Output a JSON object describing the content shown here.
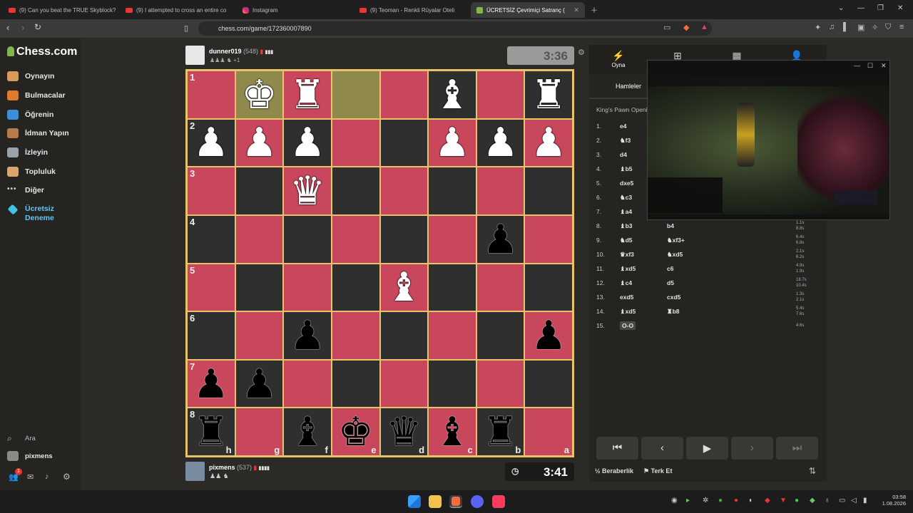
{
  "browser": {
    "tabs": [
      {
        "label": "(9) Can you beat the TRUE Skyblock?",
        "icon": "youtube-icon"
      },
      {
        "label": "(9) I attempted to cross an entire co",
        "icon": "youtube-icon"
      },
      {
        "label": "Instagram",
        "icon": "instagram-icon"
      },
      {
        "label": "(9) Teoman - Renkli Rüyalar Oteli",
        "icon": "youtube-icon"
      },
      {
        "label": "ÜCRETSİZ Çevrimiçi Satranç (",
        "icon": "chess-icon"
      }
    ],
    "url": "chess.com/game/172360007890"
  },
  "sidebar": {
    "logo": "Chess.com",
    "items": [
      {
        "label": "Oynayın"
      },
      {
        "label": "Bulmacalar"
      },
      {
        "label": "Öğrenin"
      },
      {
        "label": "İdman Yapın"
      },
      {
        "label": "İzleyin"
      },
      {
        "label": "Topluluk"
      },
      {
        "label": "Diğer"
      },
      {
        "label": "Ücretsiz\nDeneme"
      }
    ],
    "search": "Ara",
    "user": "pixmens",
    "notif_count": "1"
  },
  "top_player": {
    "name": "dunner019",
    "rating": "(548)",
    "extra": "+1",
    "clock": "3:36"
  },
  "bottom_player": {
    "name": "pixmens",
    "rating": "(537)",
    "clock": "3:41"
  },
  "board": {
    "ranks": [
      "1",
      "2",
      "3",
      "4",
      "5",
      "6",
      "7",
      "8"
    ],
    "files": [
      "h",
      "g",
      "f",
      "e",
      "d",
      "c",
      "b",
      "a"
    ],
    "rows": [
      [
        "",
        "wK",
        "wR",
        "",
        "",
        "wB",
        "",
        "wR"
      ],
      [
        "wP",
        "wP",
        "wP",
        "",
        "",
        "wP",
        "wP",
        "wP"
      ],
      [
        "",
        "",
        "wQ",
        "",
        "",
        "",
        "",
        ""
      ],
      [
        "",
        "",
        "",
        "",
        "",
        "",
        "bP",
        ""
      ],
      [
        "",
        "",
        "",
        "",
        "wB",
        "",
        "",
        ""
      ],
      [
        "",
        "",
        "bP",
        "",
        "",
        "",
        "",
        "bP"
      ],
      [
        "bP",
        "bP",
        "",
        "",
        "",
        "",
        "",
        ""
      ],
      [
        "bR",
        "",
        "bB",
        "bK",
        "bQ",
        "bB",
        "bR",
        ""
      ]
    ],
    "highlight": [
      "0-1",
      "0-3"
    ]
  },
  "panel": {
    "tabs": [
      {
        "label": "Oyna",
        "icon": "bolt-icon"
      },
      {
        "label": "",
        "icon": "plus-icon"
      },
      {
        "label": "",
        "icon": "board-icon"
      },
      {
        "label": "",
        "icon": "friends-icon"
      }
    ],
    "moves_tab": "Hamleler",
    "opening": "King's Pawn Openi",
    "moves": [
      {
        "n": "1.",
        "w": "e4",
        "b": "",
        "t": ""
      },
      {
        "n": "2.",
        "w": "♞f3",
        "b": "",
        "t": ""
      },
      {
        "n": "3.",
        "w": "d4",
        "b": "",
        "t": ""
      },
      {
        "n": "4.",
        "w": "♝b5",
        "b": "",
        "t": ""
      },
      {
        "n": "5.",
        "w": "dxe5",
        "b": "",
        "t": ""
      },
      {
        "n": "6.",
        "w": "♞c3",
        "b": "",
        "t": ""
      },
      {
        "n": "7.",
        "w": "♝a4",
        "b": "",
        "t": ""
      },
      {
        "n": "8.",
        "w": "♝b3",
        "b": "b4",
        "t": "1.1s\n8.8s"
      },
      {
        "n": "9.",
        "w": "♞d5",
        "b": "♞xf3+",
        "t": "6.4s\n6.8s"
      },
      {
        "n": "10.",
        "w": "♛xf3",
        "b": "♞xd5",
        "t": "2.1s\n6.2s"
      },
      {
        "n": "11.",
        "w": "♝xd5",
        "b": "c6",
        "t": "4.9s\n1.9s"
      },
      {
        "n": "12.",
        "w": "♝c4",
        "b": "d5",
        "t": "18.7s\n10.4s"
      },
      {
        "n": "13.",
        "w": "exd5",
        "b": "cxd5",
        "t": "1.3s\n2.1s"
      },
      {
        "n": "14.",
        "w": "♝xd5",
        "b": "♜b8",
        "t": "5.4s\n7.6s"
      },
      {
        "n": "15.",
        "w": "O-O",
        "b": "",
        "t": "4.6s"
      }
    ],
    "draw": "Beraberlik",
    "resign": "Terk Et"
  },
  "taskbar": {
    "time": "03:58",
    "date": "1.08.2026"
  }
}
